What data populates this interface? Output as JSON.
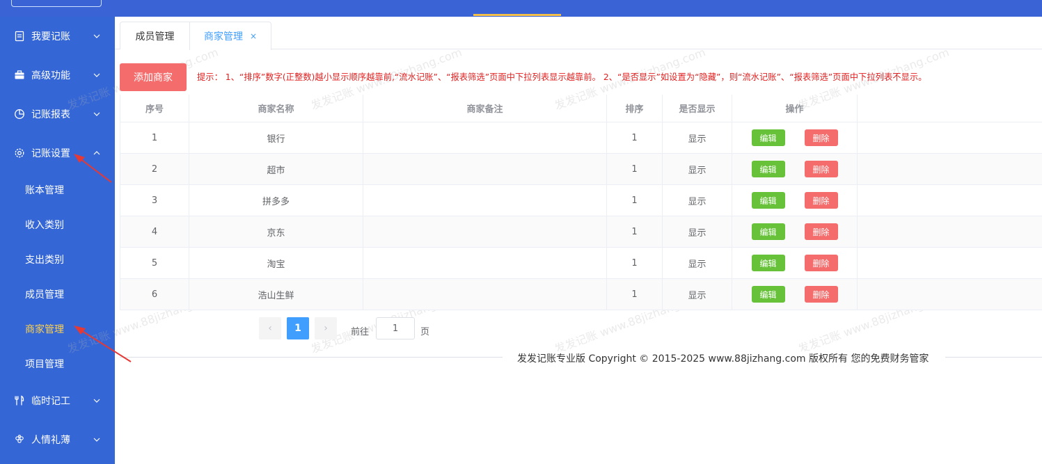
{
  "sidebar": {
    "groups": [
      {
        "label": "我要记账"
      },
      {
        "label": "高级功能"
      },
      {
        "label": "记账报表"
      },
      {
        "label": "记账设置"
      },
      {
        "label": "临时记工"
      },
      {
        "label": "人情礼薄"
      }
    ],
    "sub_items": [
      {
        "label": "账本管理"
      },
      {
        "label": "收入类别"
      },
      {
        "label": "支出类别"
      },
      {
        "label": "成员管理"
      },
      {
        "label": "商家管理"
      },
      {
        "label": "项目管理"
      }
    ]
  },
  "tabs": [
    {
      "label": "成员管理"
    },
    {
      "label": "商家管理",
      "close": "×"
    }
  ],
  "toolbar": {
    "add_label": "添加商家",
    "tip": "提示：  1、“排序”数字(正整数)越小显示顺序越靠前,“流水记账”、“报表筛选”页面中下拉列表显示越靠前。  2、“是否显示”如设置为“隐藏”，则“流水记账”、“报表筛选”页面中下拉列表不显示。"
  },
  "table": {
    "headers": [
      "序号",
      "商家名称",
      "商家备注",
      "排序",
      "是否显示",
      "操作"
    ],
    "edit_label": "编辑",
    "delete_label": "删除",
    "rows": [
      {
        "no": "1",
        "name": "银行",
        "note": "",
        "order": "1",
        "visible": "显示"
      },
      {
        "no": "2",
        "name": "超市",
        "note": "",
        "order": "1",
        "visible": "显示"
      },
      {
        "no": "3",
        "name": "拼多多",
        "note": "",
        "order": "1",
        "visible": "显示"
      },
      {
        "no": "4",
        "name": "京东",
        "note": "",
        "order": "1",
        "visible": "显示"
      },
      {
        "no": "5",
        "name": "淘宝",
        "note": "",
        "order": "1",
        "visible": "显示"
      },
      {
        "no": "6",
        "name": "浩山生鲜",
        "note": "",
        "order": "1",
        "visible": "显示"
      }
    ]
  },
  "pagination": {
    "prev": "‹",
    "next": "›",
    "current": "1",
    "goto_label": "前往",
    "goto_value": "1",
    "page_suffix": "页"
  },
  "footer": {
    "text": "发发记账专业版  Copyright © 2015-2025 www.88jizhang.com 版权所有   您的免费财务管家"
  },
  "watermark": {
    "text": "发发记账 www.88jizhang.com"
  },
  "colors": {
    "sidebar_bg": "#3466d6",
    "active_sub": "#ffd24d",
    "primary": "#409eff",
    "danger": "#f56c6c",
    "success": "#67c23a"
  }
}
